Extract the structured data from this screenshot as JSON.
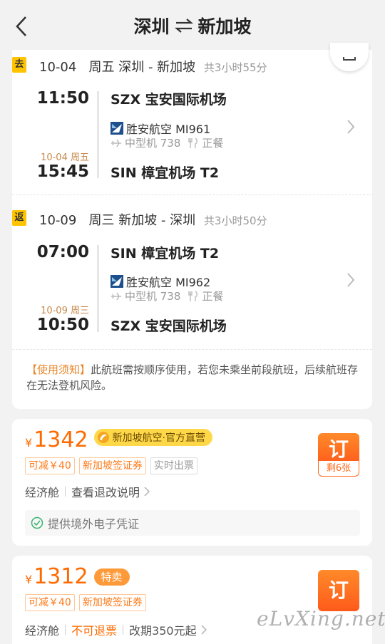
{
  "header": {
    "from": "深圳",
    "to": "新加坡"
  },
  "segments": [
    {
      "tag": "去",
      "date": "10-04",
      "weekday": "周五",
      "route": "深圳 - 新加坡",
      "duration": "共3小时55分",
      "dep_time": "11:50",
      "dep_airport": "SZX 宝安国际机场",
      "airline": "胜安航空 MI961",
      "aircraft": "中型机 738",
      "meal": "正餐",
      "arr_date": "10-04 周五",
      "arr_time": "15:45",
      "arr_airport": "SIN 樟宜机场 T2"
    },
    {
      "tag": "返",
      "date": "10-09",
      "weekday": "周三",
      "route": "新加坡 - 深圳",
      "duration": "共3小时50分",
      "dep_time": "07:00",
      "dep_airport": "SIN 樟宜机场 T2",
      "airline": "胜安航空 MI962",
      "aircraft": "中型机 738",
      "meal": "正餐",
      "arr_date": "10-09 周三",
      "arr_time": "10:50",
      "arr_airport": "SZX 宝安国际机场"
    }
  ],
  "notice": {
    "title": "【使用须知】",
    "text": "此航班需按顺序使用，若您未乘坐前段航班，后续航班存在无法登机风险。"
  },
  "offers": [
    {
      "currency": "¥",
      "price": "1342",
      "badge": "新加坡航空·官方直营",
      "tags": [
        "可减￥40",
        "新加坡签证券",
        "实时出票"
      ],
      "cabin": "经济舱",
      "policy": "查看退改说明",
      "book_label": "订",
      "remaining": "剩6张",
      "note": "提供境外电子凭证"
    },
    {
      "currency": "¥",
      "price": "1312",
      "badge": "特卖",
      "tags": [
        "可减￥40",
        "新加坡签证券"
      ],
      "cabin": "经济舱",
      "refund": "不可退票",
      "policy": "改期350元起",
      "book_label": "订"
    }
  ],
  "watermark": "eLvXing.net",
  "colors": {
    "accent": "#ff6a00",
    "tag_yellow": "#ffc400",
    "background": "#f2f2f2"
  }
}
